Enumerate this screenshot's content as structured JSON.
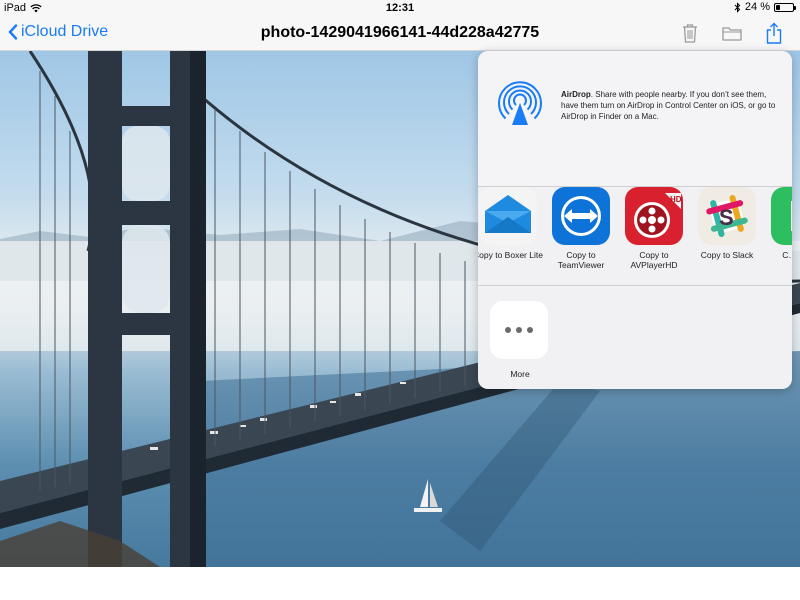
{
  "status_bar": {
    "device": "iPad",
    "time": "12:31",
    "battery": "24 %",
    "battery_level": 0.24
  },
  "nav": {
    "back_label": "iCloud Drive",
    "title": "photo-1429041966141-44d228a42775",
    "actions": [
      "trash-icon",
      "folder-icon",
      "share-icon"
    ]
  },
  "share_sheet": {
    "airdrop": {
      "title": "AirDrop",
      "description": ". Share with people nearby. If you don’t see them, have them turn on AirDrop in Control Center on iOS, or go to AirDrop in Finder on a Mac."
    },
    "apps": [
      {
        "label": "Copy to Boxer Lite",
        "icon": "boxer-icon",
        "color": "#1e8be0"
      },
      {
        "label": "Copy to TeamViewer",
        "icon": "teamviewer-icon",
        "color": "#0e73d9"
      },
      {
        "label": "Copy to AVPlayerHD",
        "icon": "avplayerhd-icon",
        "color": "#d8202f"
      },
      {
        "label": "Copy to Slack",
        "icon": "slack-icon",
        "color": "#e8e2d8"
      },
      {
        "label": "C… Ev…",
        "icon": "evernote-icon",
        "color": "#2dbe60"
      }
    ],
    "more_label": "More"
  },
  "colors": {
    "accent": "#1a7cf5",
    "airdrop": "#1a7cf5"
  }
}
